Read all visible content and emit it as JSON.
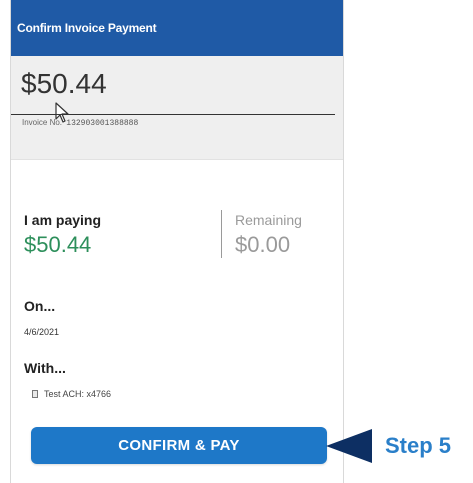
{
  "header": {
    "title": "Confirm Invoice Payment"
  },
  "amount": {
    "value": "$50.44",
    "invoice_label": "Invoice No.",
    "invoice_number": "132903001388888"
  },
  "paying": {
    "label": "I am paying",
    "value": "$50.44"
  },
  "remaining": {
    "label": "Remaining",
    "value": "$0.00"
  },
  "schedule": {
    "on_label": "On...",
    "date": "4/6/2021"
  },
  "method": {
    "with_label": "With...",
    "account": "Test ACH: x4766"
  },
  "actions": {
    "confirm_label": "CONFIRM & PAY"
  },
  "callout": {
    "step_label": "Step 5"
  },
  "colors": {
    "header_blue": "#1f5aa6",
    "button_blue": "#1e78c8",
    "paying_green": "#2d8f5b",
    "step_blue": "#2a7fc9"
  }
}
